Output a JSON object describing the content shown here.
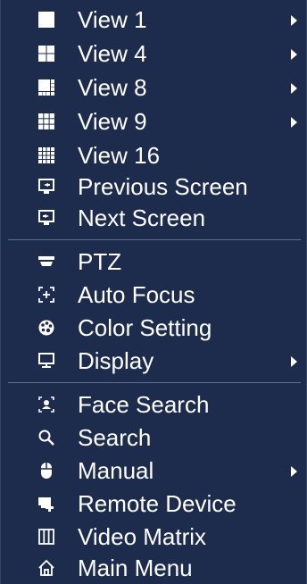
{
  "menu": {
    "items": [
      {
        "label": "View 1",
        "icon": "single-view-icon",
        "has_submenu": true
      },
      {
        "label": "View 4",
        "icon": "quad-view-icon",
        "has_submenu": true
      },
      {
        "label": "View 8",
        "icon": "eight-view-icon",
        "has_submenu": true
      },
      {
        "label": "View 9",
        "icon": "nine-view-icon",
        "has_submenu": true
      },
      {
        "label": "View 16",
        "icon": "sixteen-view-icon",
        "has_submenu": false
      },
      {
        "label": "Previous Screen",
        "icon": "previous-screen-icon",
        "has_submenu": false
      },
      {
        "label": "Next Screen",
        "icon": "next-screen-icon",
        "has_submenu": false
      },
      {
        "label": "PTZ",
        "icon": "ptz-camera-icon",
        "has_submenu": false
      },
      {
        "label": "Auto Focus",
        "icon": "auto-focus-icon",
        "has_submenu": false
      },
      {
        "label": "Color Setting",
        "icon": "color-palette-icon",
        "has_submenu": false
      },
      {
        "label": "Display",
        "icon": "monitor-icon",
        "has_submenu": true
      },
      {
        "label": "Face Search",
        "icon": "face-search-icon",
        "has_submenu": false
      },
      {
        "label": "Search",
        "icon": "search-icon",
        "has_submenu": false
      },
      {
        "label": "Manual",
        "icon": "mouse-icon",
        "has_submenu": true
      },
      {
        "label": "Remote Device",
        "icon": "remote-device-icon",
        "has_submenu": false
      },
      {
        "label": "Video Matrix",
        "icon": "video-matrix-icon",
        "has_submenu": false
      },
      {
        "label": "Main Menu",
        "icon": "home-icon",
        "has_submenu": false
      }
    ]
  },
  "colors": {
    "background": "#1d2c4c",
    "text": "#ffffff",
    "divider": "#5a6f97"
  }
}
